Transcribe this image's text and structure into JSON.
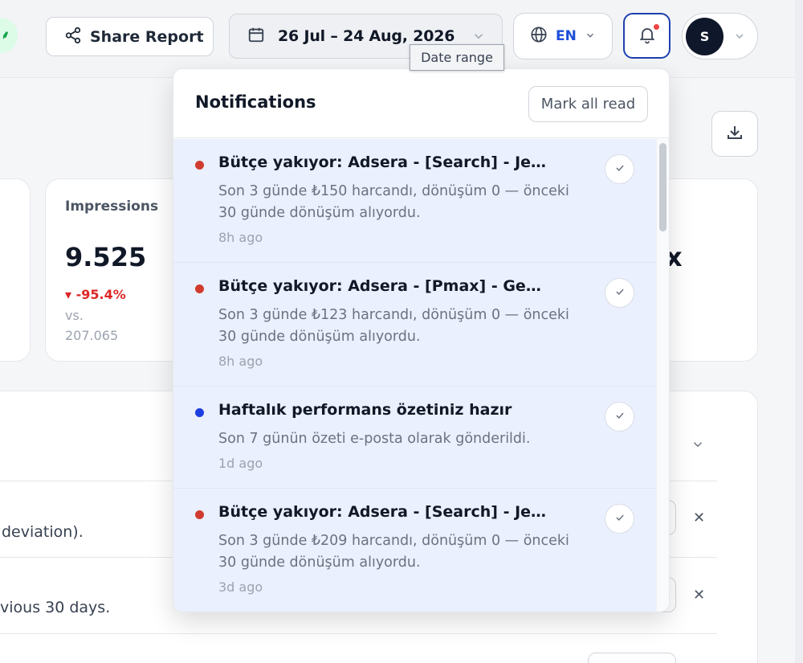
{
  "header": {
    "brand_glyph": "⸙",
    "share_label": "Share Report",
    "date_range_label": "26 Jul – 24 Aug, 2026",
    "date_tooltip": "Date range",
    "language_label": "EN",
    "user_initial": "S"
  },
  "dashboard": {
    "impressions": {
      "title": "Impressions",
      "value": "9.525",
      "delta": "▾ -95.4%",
      "vs_label": "vs.",
      "previous": "207.065"
    },
    "right_card_value": "x",
    "rows": [
      {
        "text": "deviation)."
      },
      {
        "text": "vious 30 days."
      }
    ]
  },
  "notifications": {
    "title": "Notifications",
    "mark_all_label": "Mark all read",
    "items": [
      {
        "title": "Bütçe yakıyor: Adsera - [Search] - Jenerik - Mobil",
        "body": "Son 3 günde ₺150 harcandı, dönüşüm 0 — önceki 30 günde dönüşüm alıyordu.",
        "time": "8h ago",
        "dot_color": "#d13b2f"
      },
      {
        "title": "Bütçe yakıyor: Adsera - [Pmax] - Generalists",
        "body": "Son 3 günde ₺123 harcandı, dönüşüm 0 — önceki 30 günde dönüşüm alıyordu.",
        "time": "8h ago",
        "dot_color": "#d13b2f"
      },
      {
        "title": "Haftalık performans özetiniz hazır",
        "body": "Son 7 günün özeti e-posta olarak gönderildi.",
        "time": "1d ago",
        "dot_color": "#1d3ee0"
      },
      {
        "title": "Bütçe yakıyor: Adsera - [Search] - Jenerik - Desktop",
        "body": "Son 3 günde ₺209 harcandı, dönüşüm 0 — önceki 30 günde dönüşüm alıyordu.",
        "time": "3d ago",
        "dot_color": "#d13b2f"
      }
    ]
  },
  "icons": {
    "share": "share-icon",
    "calendar": "calendar-icon",
    "globe": "globe-icon",
    "bell": "bell-icon",
    "download": "download-icon",
    "check": "check-icon",
    "close": "close-icon",
    "chevron": "chevron-down-icon"
  }
}
